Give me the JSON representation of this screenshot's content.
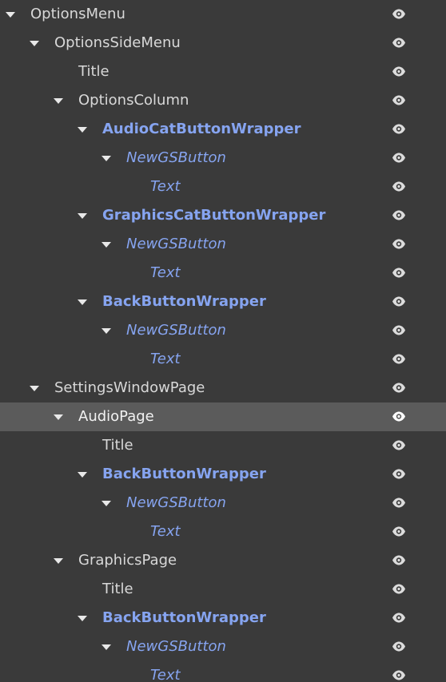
{
  "tree": {
    "nodes": [
      {
        "name": "OptionsMenu",
        "depth": 0,
        "expanded": true,
        "style": "normal"
      },
      {
        "name": "OptionsSideMenu",
        "depth": 1,
        "expanded": true,
        "style": "normal"
      },
      {
        "name": "Title",
        "depth": 2,
        "expanded": false,
        "style": "normal"
      },
      {
        "name": "OptionsColumn",
        "depth": 2,
        "expanded": true,
        "style": "normal"
      },
      {
        "name": "AudioCatButtonWrapper",
        "depth": 3,
        "expanded": true,
        "style": "bold-blue"
      },
      {
        "name": "NewGSButton",
        "depth": 4,
        "expanded": true,
        "style": "italic-blue"
      },
      {
        "name": "Text",
        "depth": 5,
        "expanded": false,
        "style": "italic-blue"
      },
      {
        "name": "GraphicsCatButtonWrapper",
        "depth": 3,
        "expanded": true,
        "style": "bold-blue"
      },
      {
        "name": "NewGSButton",
        "depth": 4,
        "expanded": true,
        "style": "italic-blue"
      },
      {
        "name": "Text",
        "depth": 5,
        "expanded": false,
        "style": "italic-blue"
      },
      {
        "name": "BackButtonWrapper",
        "depth": 3,
        "expanded": true,
        "style": "bold-blue"
      },
      {
        "name": "NewGSButton",
        "depth": 4,
        "expanded": true,
        "style": "italic-blue"
      },
      {
        "name": "Text",
        "depth": 5,
        "expanded": false,
        "style": "italic-blue"
      },
      {
        "name": "SettingsWindowPage",
        "depth": 1,
        "expanded": true,
        "style": "normal"
      },
      {
        "name": "AudioPage",
        "depth": 2,
        "expanded": true,
        "style": "normal",
        "selected": true
      },
      {
        "name": "Title",
        "depth": 3,
        "expanded": false,
        "style": "normal"
      },
      {
        "name": "BackButtonWrapper",
        "depth": 3,
        "expanded": true,
        "style": "bold-blue"
      },
      {
        "name": "NewGSButton",
        "depth": 4,
        "expanded": true,
        "style": "italic-blue"
      },
      {
        "name": "Text",
        "depth": 5,
        "expanded": false,
        "style": "italic-blue"
      },
      {
        "name": "GraphicsPage",
        "depth": 2,
        "expanded": true,
        "style": "normal"
      },
      {
        "name": "Title",
        "depth": 3,
        "expanded": false,
        "style": "normal"
      },
      {
        "name": "BackButtonWrapper",
        "depth": 3,
        "expanded": true,
        "style": "bold-blue"
      },
      {
        "name": "NewGSButton",
        "depth": 4,
        "expanded": true,
        "style": "italic-blue"
      },
      {
        "name": "Text",
        "depth": 5,
        "expanded": false,
        "style": "italic-blue"
      }
    ]
  },
  "icons": {
    "expand_arrow": "triangle-down-icon",
    "visibility": "eye-icon"
  },
  "colors": {
    "background": "#3a3a3a",
    "selected_row": "#5b5b5b",
    "text": "#d8d8d8",
    "accent_blue": "#86a4f0"
  }
}
